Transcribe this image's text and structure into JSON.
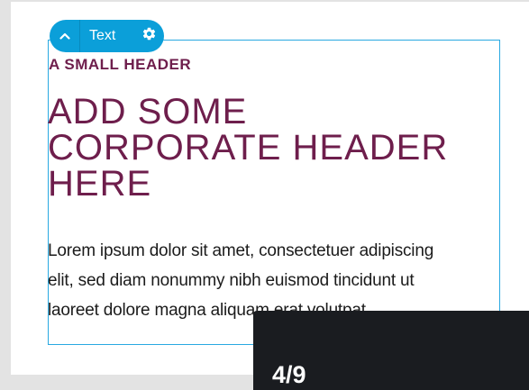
{
  "toolbar": {
    "label": "Text",
    "collapse_icon": "chevron-up-icon",
    "settings_icon": "gear-icon",
    "accent": "#0b9fd9"
  },
  "content": {
    "small_header": "A SMALL HEADER",
    "big_header_lines": [
      "ADD SOME",
      "CORPORATE HEADER",
      "HERE"
    ],
    "body_lines": [
      "Lorem ipsum dolor sit amet, consectetuer adipiscing",
      "elit, sed diam nonummy nibh euismod tincidunt ut",
      "laoreet dolore magna aliquam erat volutpat."
    ],
    "header_color": "#6e1e4c",
    "selection_color": "#29a9e1"
  },
  "pager": {
    "counter": "4/9"
  }
}
